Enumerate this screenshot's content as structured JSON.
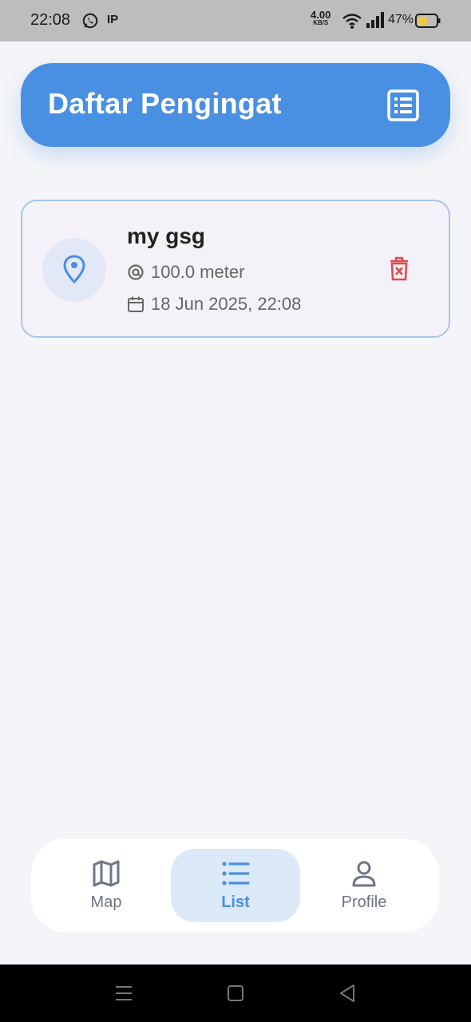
{
  "status_bar": {
    "time": "22:08",
    "ip_label": "IP",
    "speed_value": "4.00",
    "speed_unit": "KB/S",
    "battery_pct": "47%"
  },
  "header": {
    "title": "Daftar Pengingat",
    "icon": "list-document-icon"
  },
  "reminders": [
    {
      "title": "my gsg",
      "radius": "100.0 meter",
      "datetime": "18 Jun 2025, 22:08",
      "icon": "location-pin-icon"
    }
  ],
  "bottom_nav": {
    "items": [
      {
        "label": "Map",
        "icon": "map-icon",
        "active": false
      },
      {
        "label": "List",
        "icon": "list-icon",
        "active": true
      },
      {
        "label": "Profile",
        "icon": "person-icon",
        "active": false
      }
    ]
  },
  "colors": {
    "primary": "#4a90e2",
    "delete": "#e24b4b",
    "card_bg": "#f5f1f9",
    "card_border": "#a6c6ec",
    "background": "#f4f5f8"
  }
}
